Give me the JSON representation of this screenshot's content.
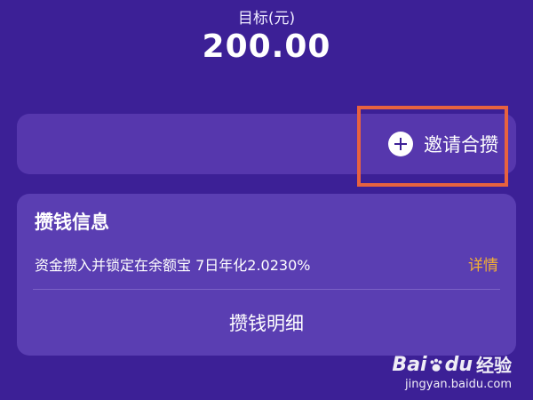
{
  "goal": {
    "label": "目标(元)",
    "amount": "200.00"
  },
  "invite": {
    "label": "邀请合攒"
  },
  "info": {
    "title": "攒钱信息",
    "description": "资金攒入并锁定在余额宝 7日年化2.0230%",
    "detail_link": "详情",
    "history_label": "攒钱明细"
  },
  "watermark": {
    "brand_left": "Bai",
    "brand_right": "du",
    "brand_suffix": "经验",
    "url": "jingyan.baidu.com"
  },
  "colors": {
    "background": "#3c2096",
    "card": "#5a3eb2",
    "highlight": "#e8623f",
    "detail_link": "#f4b033"
  }
}
